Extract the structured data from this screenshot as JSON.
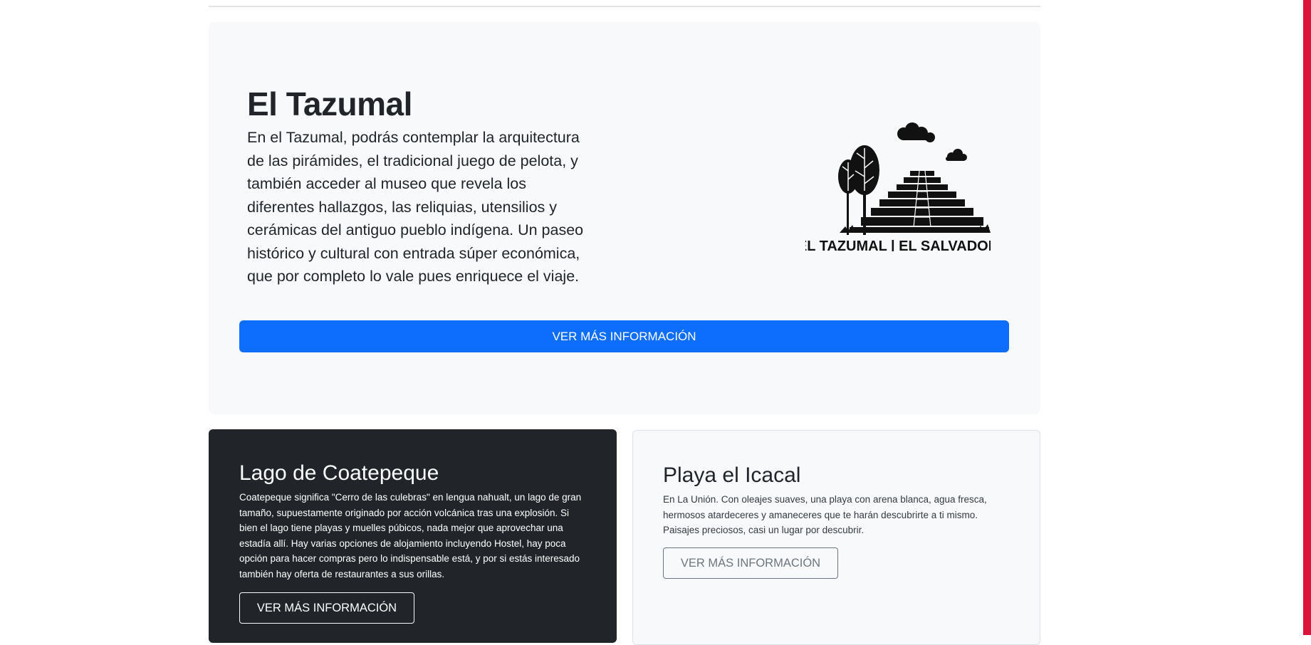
{
  "hero": {
    "title": "El Tazumal",
    "description": "En el Tazumal, podrás contemplar la arquitectura de las pirámides, el tradicional juego de pelota, y también acceder al museo que revela los diferentes hallazgos, las reliquias, utensilios y cerámicas del antiguo pueblo indígena. Un paseo histórico y cultural con entrada súper económica, que por completo lo vale pues enriquece el viaje.",
    "logo_text": "EL TAZUMAL | EL SALVADOR",
    "button_label": "VER MÁS INFORMACIÓN"
  },
  "cards": [
    {
      "title": "Lago de Coatepeque",
      "text": "Coatepeque significa \"Cerro de las culebras\" en lengua nahualt, un lago de gran tamaño, supuestamente originado por acción volcánica tras una explosión. Si bien el lago tiene playas y muelles púbicos, nada mejor que aprovechar una estadía allí. Hay varias opciones de alojamiento incluyendo Hostel, hay poca opción para hacer compras pero lo indispensable está, y por si estás interesado también hay oferta de restaurantes a sus orillas.",
      "button_label": "VER MÁS INFORMACIÓN",
      "theme": "dark"
    },
    {
      "title": "Playa el Icacal",
      "text": "En La Unión. Con oleajes suaves, una playa con arena blanca, agua fresca, hermosos atardeceres y amaneceres que te harán descubrirte a ti mismo. Paisajes preciosos, casi un lugar por descubrir.",
      "button_label": "VER MÁS INFORMACIÓN",
      "theme": "light"
    }
  ],
  "colors": {
    "primary": "#0d6efd",
    "dark_card": "#212529",
    "light_bg": "#f8f9fa",
    "scrollbar_accent": "#dc143c"
  }
}
